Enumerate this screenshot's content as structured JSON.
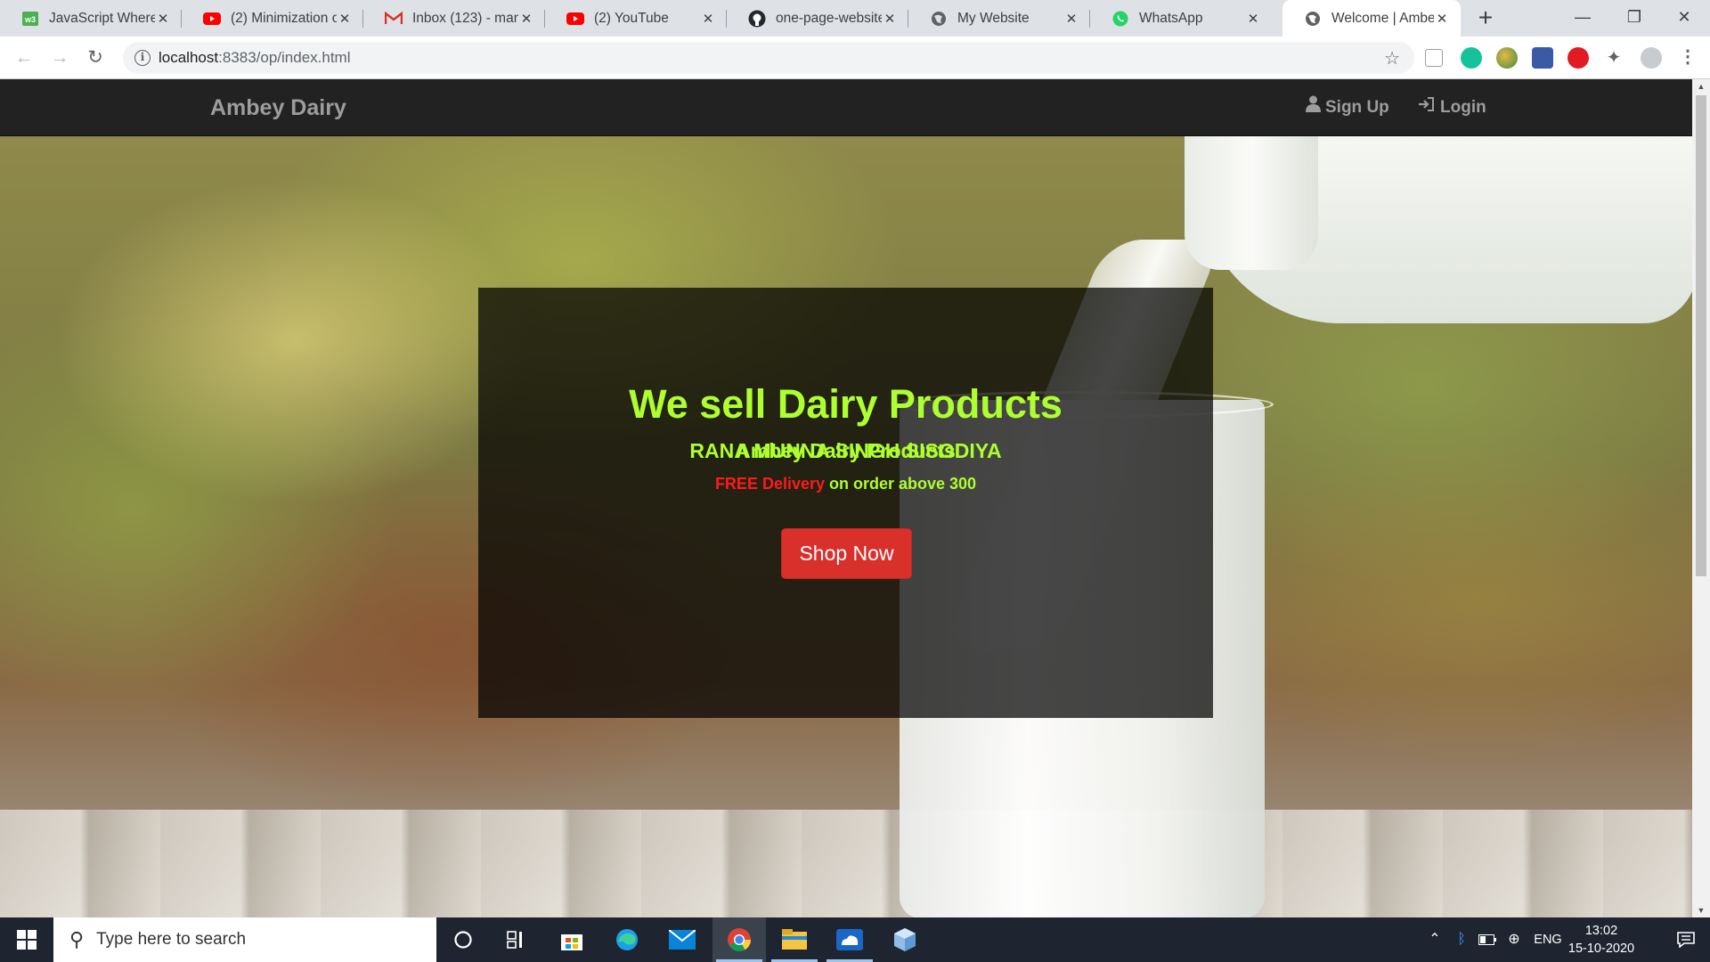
{
  "browser": {
    "tabs": [
      {
        "title": "JavaScript Where T",
        "icon": "w3schools-icon"
      },
      {
        "title": "(2) Minimization of",
        "icon": "youtube-icon"
      },
      {
        "title": "Inbox (123) - mani",
        "icon": "gmail-icon"
      },
      {
        "title": "(2) YouTube",
        "icon": "youtube-icon"
      },
      {
        "title": "one-page-website",
        "icon": "github-icon"
      },
      {
        "title": "My Website",
        "icon": "globe-icon"
      },
      {
        "title": "WhatsApp",
        "icon": "whatsapp-icon"
      },
      {
        "title": "Welcome | Ambey",
        "icon": "globe-icon",
        "active": true
      }
    ],
    "url_host": "localhost",
    "url_rest": ":8383/op/index.html"
  },
  "site": {
    "brand": "Ambey Dairy",
    "nav": {
      "signup": "Sign Up",
      "login": "Login"
    },
    "hero": {
      "title": "We sell Dairy Products",
      "subtitle": "Ambey Dairy Products",
      "delivery_red": "FREE Delivery",
      "delivery_rest": " on order above 300",
      "button": "Shop Now",
      "owner": "RANA MUNNA SINGH SISODIYA"
    }
  },
  "taskbar": {
    "search_placeholder": "Type here to search",
    "lang": "ENG",
    "time": "13:02",
    "date": "15-10-2020"
  },
  "colors": {
    "accent_green": "#adff2f",
    "button_red": "#d9302c",
    "navbar_bg": "#222222"
  }
}
